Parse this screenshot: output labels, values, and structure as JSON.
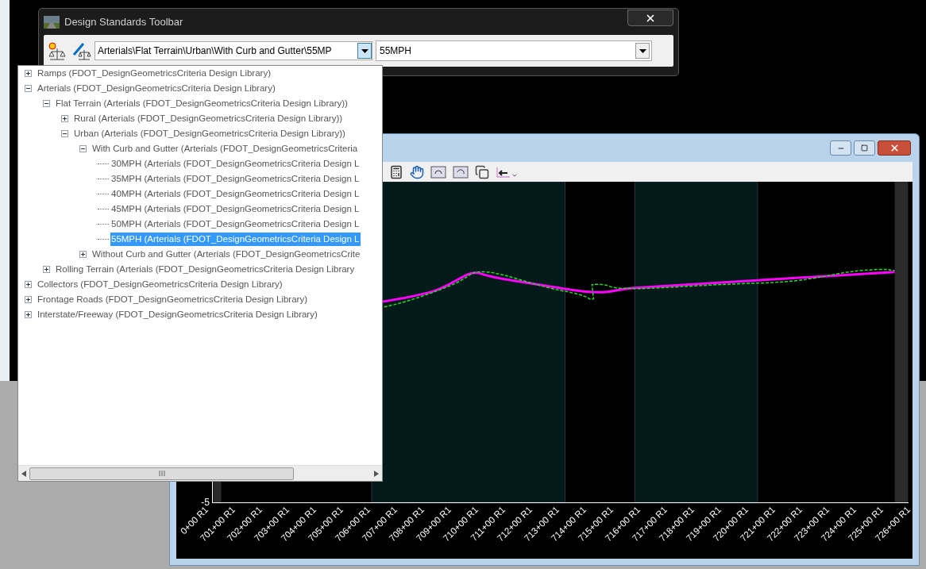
{
  "toolbar_window": {
    "title": "Design Standards Toolbar",
    "standard_path": "Arterials\\Flat Terrain\\Urban\\With Curb and Gutter\\55MP",
    "speed": "55MPH"
  },
  "tree": [
    {
      "label": "Ramps (FDOT_DesignGeometricsCriteria Design Library)",
      "expanded": false,
      "selected": false
    },
    {
      "label": "Arterials (FDOT_DesignGeometricsCriteria Design Library)",
      "expanded": true,
      "selected": false,
      "children": [
        {
          "label": "Flat Terrain (Arterials (FDOT_DesignGeometricsCriteria Design Library))",
          "expanded": true,
          "selected": false,
          "children": [
            {
              "label": "Rural (Arterials (FDOT_DesignGeometricsCriteria Design Library))",
              "expanded": false,
              "selected": false
            },
            {
              "label": "Urban (Arterials (FDOT_DesignGeometricsCriteria Design Library))",
              "expanded": true,
              "selected": false,
              "children": [
                {
                  "label": "With Curb and Gutter (Arterials (FDOT_DesignGeometricsCriteria",
                  "expanded": true,
                  "selected": false,
                  "children": [
                    {
                      "label": "30MPH (Arterials (FDOT_DesignGeometricsCriteria Design L",
                      "selected": false
                    },
                    {
                      "label": "35MPH (Arterials (FDOT_DesignGeometricsCriteria Design L",
                      "selected": false
                    },
                    {
                      "label": "40MPH (Arterials (FDOT_DesignGeometricsCriteria Design L",
                      "selected": false
                    },
                    {
                      "label": "45MPH (Arterials (FDOT_DesignGeometricsCriteria Design L",
                      "selected": false
                    },
                    {
                      "label": "50MPH (Arterials (FDOT_DesignGeometricsCriteria Design L",
                      "selected": false
                    },
                    {
                      "label": "55MPH (Arterials (FDOT_DesignGeometricsCriteria Design L",
                      "selected": true
                    }
                  ]
                },
                {
                  "label": "Without Curb and Gutter (Arterials (FDOT_DesignGeometricsCrite",
                  "expanded": false,
                  "selected": false
                }
              ]
            }
          ]
        },
        {
          "label": "Rolling Terrain (Arterials (FDOT_DesignGeometricsCriteria Design Library",
          "expanded": false,
          "selected": false
        }
      ]
    },
    {
      "label": "Collectors (FDOT_DesignGeometricsCriteria Design Library)",
      "expanded": false,
      "selected": false
    },
    {
      "label": "Frontage Roads (FDOT_DesignGeometricsCriteria Design Library)",
      "expanded": false,
      "selected": false
    },
    {
      "label": "Interstate/Freeway (FDOT_DesignGeometricsCriteria Design Library)",
      "expanded": false,
      "selected": false
    }
  ],
  "profile_window": {
    "y_tick": "-5",
    "stations": [
      "0+00 R1",
      "701+00 R1",
      "702+00 R1",
      "703+00 R1",
      "704+00 R1",
      "705+00 R1",
      "706+00 R1",
      "707+00 R1",
      "708+00 R1",
      "709+00 R1",
      "710+00 R1",
      "711+00 R1",
      "712+00 R1",
      "713+00 R1",
      "714+00 R1",
      "715+00 R1",
      "716+00 R1",
      "717+00 R1",
      "718+00 R1",
      "719+00 R1",
      "720+00 R1",
      "721+00 R1",
      "722+00 R1",
      "723+00 R1",
      "724+00 R1",
      "725+00 R1",
      "726+00 R1"
    ]
  }
}
